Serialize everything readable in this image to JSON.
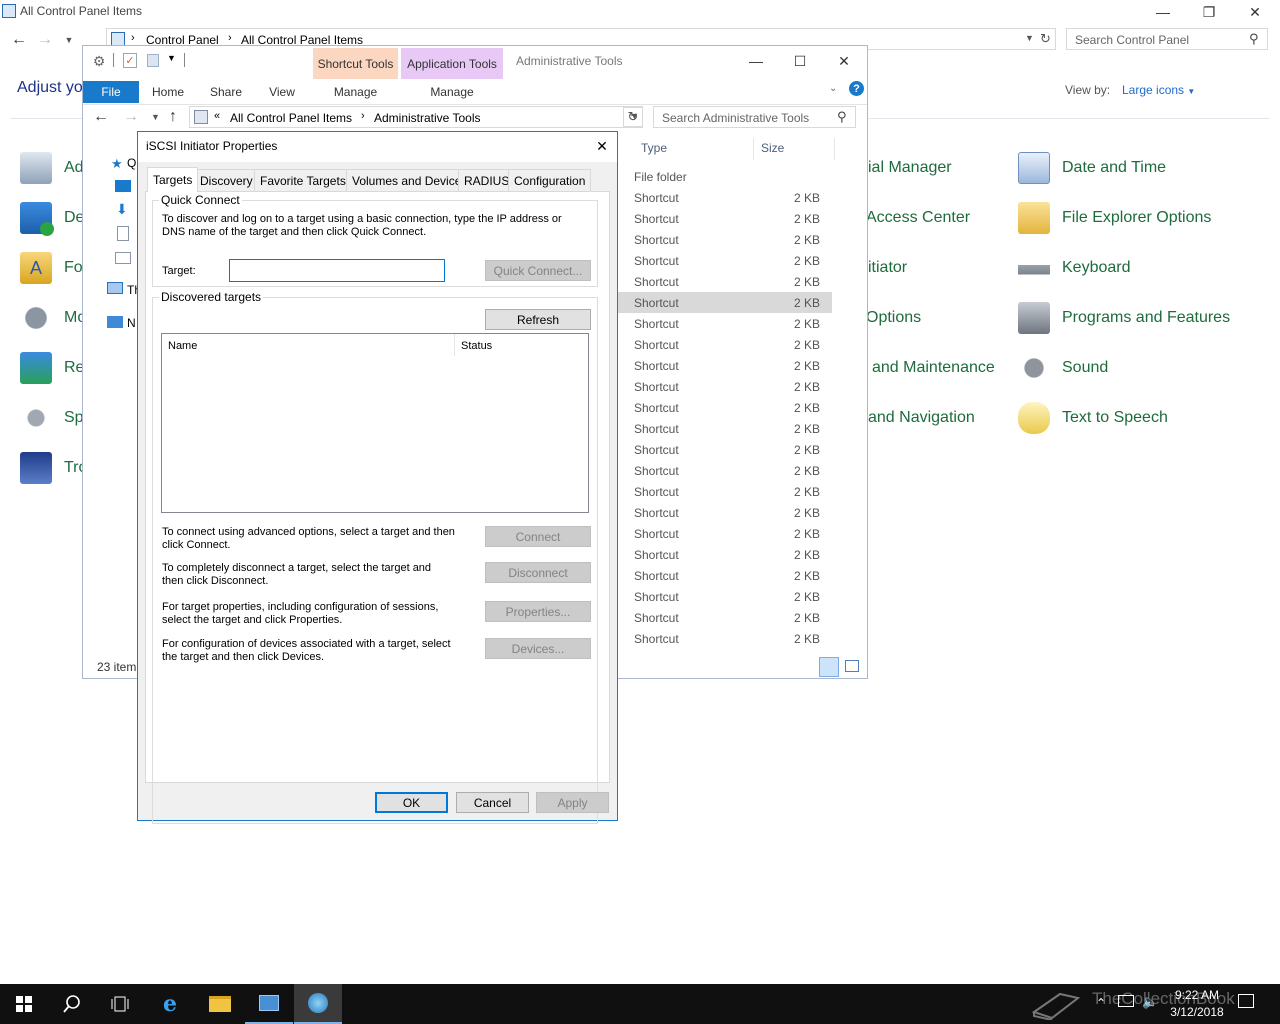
{
  "control_panel": {
    "title": "All Control Panel Items",
    "breadcrumb": [
      "Control Panel",
      "All Control Panel Items"
    ],
    "search_placeholder": "Search Control Panel",
    "heading": "Adjust yo",
    "view_by_label": "View by:",
    "view_by_value": "Large icons",
    "left_items": [
      {
        "label": "Ad",
        "icon": "admin-tools-icon"
      },
      {
        "label": "De",
        "icon": "default-programs-icon"
      },
      {
        "label": "Fo",
        "icon": "fonts-icon"
      },
      {
        "label": "Mo",
        "icon": "mouse-icon"
      },
      {
        "label": "Re",
        "icon": "recovery-icon"
      },
      {
        "label": "Spe",
        "icon": "speech-recognition-icon"
      },
      {
        "label": "Tro",
        "icon": "troubleshooting-icon"
      }
    ],
    "mid_items": [
      "ial Manager",
      "Access Center",
      "itiator",
      "Options",
      "and Maintenance",
      "and Navigation"
    ],
    "right_items": [
      {
        "label": "Date and Time",
        "icon": "date-time-icon"
      },
      {
        "label": "File Explorer Options",
        "icon": "file-explorer-options-icon"
      },
      {
        "label": "Keyboard",
        "icon": "keyboard-icon"
      },
      {
        "label": "Programs and Features",
        "icon": "programs-features-icon"
      },
      {
        "label": "Sound",
        "icon": "sound-icon"
      },
      {
        "label": "Text to Speech",
        "icon": "text-to-speech-icon"
      }
    ]
  },
  "admin_tools": {
    "title": "Administrative Tools",
    "context_tabs": [
      "Shortcut Tools",
      "Application Tools"
    ],
    "ribbon_tabs": [
      "File",
      "Home",
      "Share",
      "View",
      "Manage",
      "Manage"
    ],
    "breadcrumb": [
      "All Control Panel Items",
      "Administrative Tools"
    ],
    "search_placeholder": "Search Administrative Tools",
    "columns": {
      "type": "Type",
      "size": "Size"
    },
    "nav_labels": [
      "Q",
      "Th",
      "N"
    ],
    "status": "23 item",
    "rows": [
      {
        "type": "File folder",
        "size": ""
      },
      {
        "type": "Shortcut",
        "size": "2 KB"
      },
      {
        "type": "Shortcut",
        "size": "2 KB"
      },
      {
        "type": "Shortcut",
        "size": "2 KB"
      },
      {
        "type": "Shortcut",
        "size": "2 KB"
      },
      {
        "type": "Shortcut",
        "size": "2 KB"
      },
      {
        "type": "Shortcut",
        "size": "2 KB"
      },
      {
        "type": "Shortcut",
        "size": "2 KB"
      },
      {
        "type": "Shortcut",
        "size": "2 KB"
      },
      {
        "type": "Shortcut",
        "size": "2 KB"
      },
      {
        "type": "Shortcut",
        "size": "2 KB"
      },
      {
        "type": "Shortcut",
        "size": "2 KB"
      },
      {
        "type": "Shortcut",
        "size": "2 KB"
      },
      {
        "type": "Shortcut",
        "size": "2 KB"
      },
      {
        "type": "Shortcut",
        "size": "2 KB"
      },
      {
        "type": "Shortcut",
        "size": "2 KB"
      },
      {
        "type": "Shortcut",
        "size": "2 KB"
      },
      {
        "type": "Shortcut",
        "size": "2 KB"
      },
      {
        "type": "Shortcut",
        "size": "2 KB"
      },
      {
        "type": "Shortcut",
        "size": "2 KB"
      },
      {
        "type": "Shortcut",
        "size": "2 KB"
      },
      {
        "type": "Shortcut",
        "size": "2 KB"
      },
      {
        "type": "Shortcut",
        "size": "2 KB"
      }
    ],
    "selected_row": 6
  },
  "dialog": {
    "title": "iSCSI Initiator Properties",
    "tabs": [
      "Targets",
      "Discovery",
      "Favorite Targets",
      "Volumes and Devices",
      "RADIUS",
      "Configuration"
    ],
    "active_tab": "Targets",
    "quick_connect": {
      "legend": "Quick Connect",
      "description": "To discover and log on to a target using a basic connection, type the IP address or DNS name of the target and then click Quick Connect.",
      "target_label": "Target:",
      "target_value": "",
      "button": "Quick Connect..."
    },
    "discovered": {
      "legend": "Discovered targets",
      "refresh": "Refresh",
      "col_name": "Name",
      "col_status": "Status"
    },
    "actions": [
      {
        "text": "To connect using advanced options, select a target and then click Connect.",
        "button": "Connect"
      },
      {
        "text": "To completely disconnect a target, select the target and then click Disconnect.",
        "button": "Disconnect"
      },
      {
        "text": "For target properties, including configuration of sessions, select the target and click Properties.",
        "button": "Properties..."
      },
      {
        "text": "For configuration of devices associated with a target, select the target and then click Devices.",
        "button": "Devices..."
      }
    ],
    "ok": "OK",
    "cancel": "Cancel",
    "apply": "Apply"
  },
  "taskbar": {
    "time": "9:22 AM",
    "date": "3/12/2018",
    "watermark": "TheCollectionBook"
  },
  "colors": {
    "accent": "#1979ca",
    "link_green": "#1e6b3c",
    "shortcut_tools_tab": "#fbd7c1",
    "application_tools_tab": "#e8c9f5"
  }
}
